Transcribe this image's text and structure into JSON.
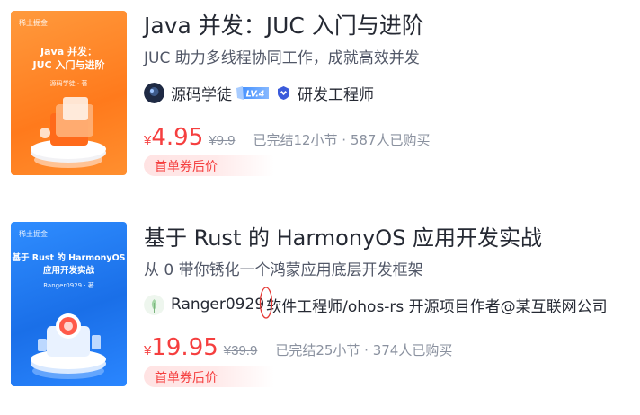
{
  "courses": [
    {
      "cover": {
        "brand": "稀土掘金",
        "title_line1": "Java 并发：",
        "title_line2": "JUC 入门与进阶",
        "author": "源码学徒 · 著"
      },
      "title": "Java 并发：JUC 入门与进阶",
      "subtitle": "JUC 助力多线程协同工作，成就高效并发",
      "author": {
        "name": "源码学徒",
        "level": "LV.4",
        "role": "研发工程师"
      },
      "price": {
        "currency": "¥",
        "current": "4.95",
        "original": "¥9.9"
      },
      "meta": "已完结12小节 · 587人已购买",
      "coupon": "首单券后价"
    },
    {
      "cover": {
        "brand": "稀土掘金",
        "title_line1": "基于 Rust 的 HarmonyOS",
        "title_line2": "应用开发实战",
        "author": "Ranger0929 · 著"
      },
      "title": "基于 Rust 的 HarmonyOS 应用开发实战",
      "subtitle": "从 0 带你锈化一个鸿蒙应用底层开发框架",
      "author": {
        "name": "Ranger0929",
        "role": "软件工程师/ohos-rs 开源项目作者@某互联网公司"
      },
      "price": {
        "currency": "¥",
        "current": "19.95",
        "original": "¥39.9"
      },
      "meta": "已完结25小节 · 374人已购买",
      "coupon": "首单券后价"
    }
  ],
  "colors": {
    "price": "#f53f3f",
    "muted": "#8a919f",
    "title": "#252933",
    "cover1": "#ff8a2a",
    "cover2": "#2a7ef5"
  }
}
